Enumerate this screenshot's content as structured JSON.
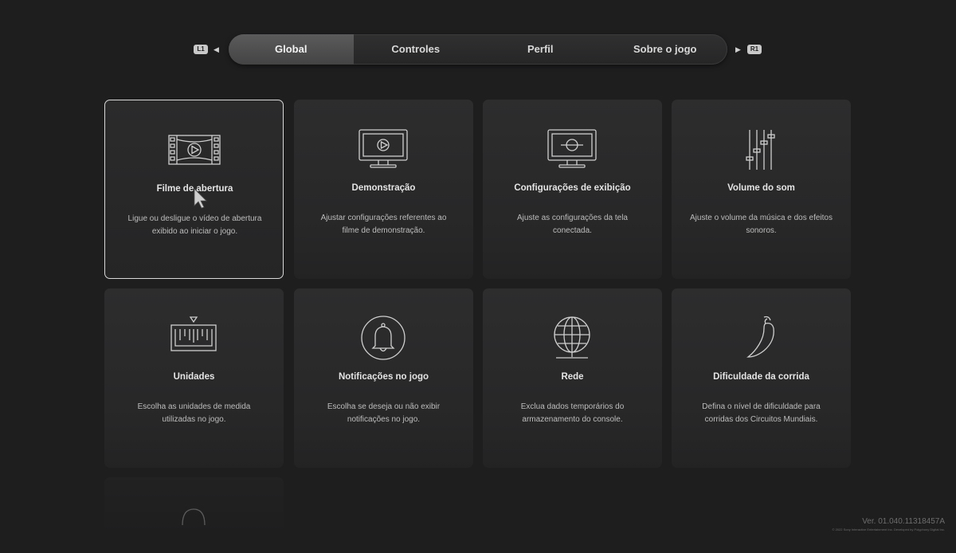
{
  "nav": {
    "left_button": "L1",
    "right_button": "R1",
    "tabs": [
      {
        "label": "Global",
        "active": true
      },
      {
        "label": "Controles",
        "active": false
      },
      {
        "label": "Perfil",
        "active": false
      },
      {
        "label": "Sobre o jogo",
        "active": false
      }
    ]
  },
  "cards": [
    {
      "icon": "film-reel-icon",
      "title": "Filme de abertura",
      "desc": "Ligue ou desligue o vídeo de abertura exibido ao iniciar o jogo.",
      "selected": true
    },
    {
      "icon": "monitor-play-icon",
      "title": "Demonstração",
      "desc": "Ajustar configurações referentes ao filme de demonstração."
    },
    {
      "icon": "monitor-display-icon",
      "title": "Configurações de exibição",
      "desc": "Ajuste as configurações da tela conectada."
    },
    {
      "icon": "sliders-icon",
      "title": "Volume do som",
      "desc": "Ajuste o volume da música e dos efeitos sonoros."
    },
    {
      "icon": "ruler-icon",
      "title": "Unidades",
      "desc": "Escolha as unidades de medida utilizadas no jogo."
    },
    {
      "icon": "bell-icon",
      "title": "Notificações no jogo",
      "desc": "Escolha se deseja ou não exibir notificações no jogo."
    },
    {
      "icon": "globe-network-icon",
      "title": "Rede",
      "desc": "Exclua dados temporários do armazenamento do console."
    },
    {
      "icon": "chili-pepper-icon",
      "title": "Dificuldade da corrida",
      "desc": "Defina o nível de dificuldade para corridas dos Circuitos Mundiais."
    }
  ],
  "footer": {
    "version": "Ver. 01.040.11318457A",
    "copyright": "© 2022 Sony Interactive Entertainment Inc. Developed by Polyphony Digital Inc."
  },
  "colors": {
    "background": "#1e1e1f",
    "card": "#2b2b2c",
    "selected_border": "#d9d9d9",
    "active_tab": "#505051"
  }
}
